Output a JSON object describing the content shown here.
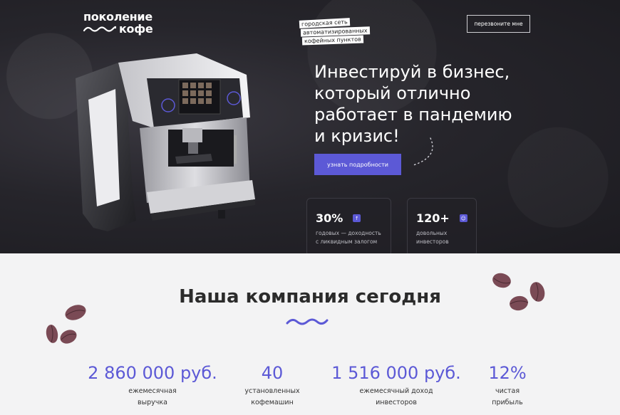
{
  "header": {
    "logo_line1": "поколение",
    "logo_line2": "кофе",
    "tagline": [
      "городская сеть",
      "автоматизированных",
      "кофейных пунктов"
    ],
    "callback_label": "перезвоните мне"
  },
  "hero": {
    "headline_lines": [
      "Инвестируй в бизнес,",
      "который отлично",
      "работает в пандемию",
      "и кризис!"
    ],
    "cta_label": "узнать подробности",
    "stats": [
      {
        "value": "30%",
        "badge": "↑",
        "label_lines": [
          "годовых — доходность",
          "с ликвидным залогом"
        ]
      },
      {
        "value": "120+",
        "badge": "☺",
        "label_lines": [
          "довольных",
          "инвесторов"
        ]
      }
    ]
  },
  "company": {
    "title": "Наша компания сегодня",
    "metrics": [
      {
        "value": "2 860 000 руб.",
        "caption_lines": [
          "ежемесячная",
          "выручка"
        ]
      },
      {
        "value": "40",
        "caption_lines": [
          "установленных",
          "кофемашин"
        ]
      },
      {
        "value": "1 516 000 руб.",
        "caption_lines": [
          "ежемесячный доход",
          "инвесторов"
        ]
      },
      {
        "value": "12%",
        "caption_lines": [
          "чистая",
          "прибыль"
        ]
      }
    ]
  },
  "colors": {
    "accent": "#5c59d6",
    "hero_bg": "#24232a",
    "section_bg": "#f3f3f4",
    "bean": "#7a4a55"
  },
  "icons": [
    "wave-logo-icon",
    "arrow-up-icon",
    "smile-icon",
    "coffee-machine-image",
    "coffee-bean-icon",
    "wave-divider-icon"
  ]
}
